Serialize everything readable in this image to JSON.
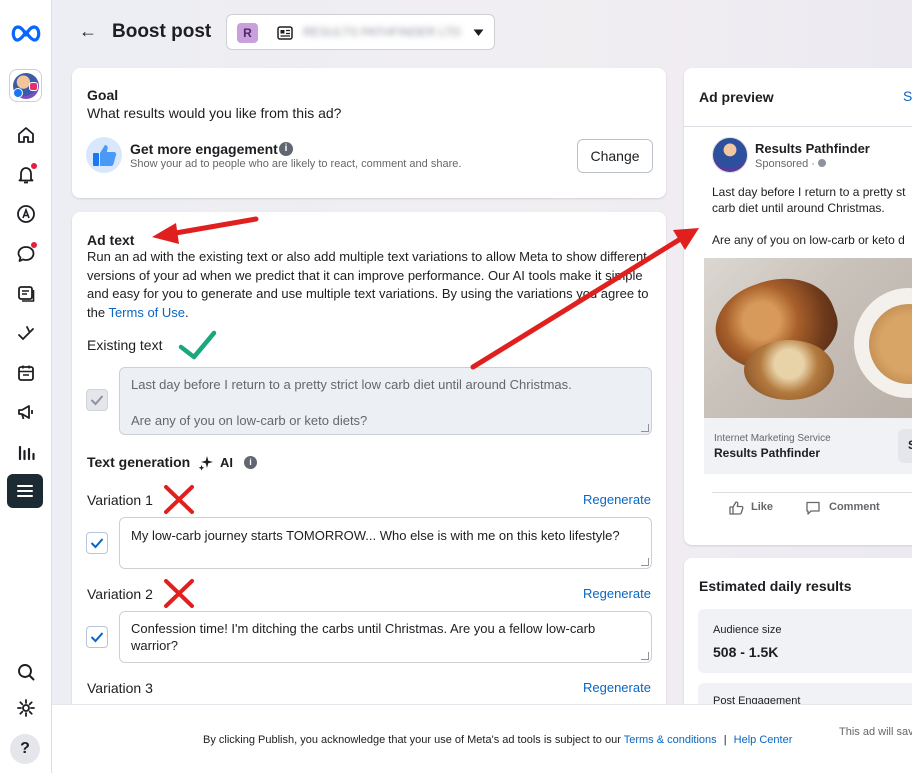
{
  "header": {
    "back_label": "←",
    "title": "Boost post",
    "page_selector_badge": "R",
    "page_selector_name": "RESULTS PATHFINDER LTD"
  },
  "goal": {
    "heading": "Goal",
    "question": "What results would you like from this ad?",
    "option_title": "Get more engagement",
    "option_desc": "Show your ad to people who are likely to react, comment and share.",
    "change_label": "Change"
  },
  "ad_text": {
    "heading": "Ad text",
    "description_before": "Run an ad with the existing text or also add multiple text variations to allow Meta to show different versions of your ad when we predict that it can improve performance. Our AI tools make it simple and easy for you to generate and use multiple text variations. By using the variations you agree to the ",
    "terms_link": "Terms of Use",
    "description_after": ".",
    "existing_label": "Existing text",
    "existing_line1": "Last day before I return to a pretty strict low carb diet until around Christmas.",
    "existing_line2": "Are any of you on low-carb or keto diets?",
    "generation_label": "Text generation",
    "ai_label": "AI",
    "regenerate_label": "Regenerate",
    "variations": [
      {
        "label": "Variation 1",
        "text": "My low-carb journey starts TOMORROW... Who else is with me on this keto lifestyle?"
      },
      {
        "label": "Variation 2",
        "text": "Confession time! I'm ditching the carbs until Christmas. Are you a fellow low-carb warrior?"
      },
      {
        "label": "Variation 3",
        "text": ""
      }
    ]
  },
  "preview": {
    "heading": "Ad preview",
    "see_label": "Se",
    "page_name": "Results Pathfinder",
    "sponsored": "Sponsored · ",
    "post_line1": "Last day before I return to a pretty st",
    "post_line2": "carb diet until around Christmas.",
    "post_line3": "Are any of you on low-carb or keto d",
    "link_category": "Internet Marketing Service",
    "link_name": "Results Pathfinder",
    "cta_partial": "S",
    "like_label": "Like",
    "comment_label": "Comment"
  },
  "estimates": {
    "heading": "Estimated daily results",
    "audience_label": "Audience size",
    "audience_value": "508 - 1.5K",
    "engagement_label": "Post Engagement"
  },
  "footer": {
    "text": "By clicking Publish, you acknowledge that your use of Meta's ad tools is subject to our ",
    "terms_link": "Terms & conditions",
    "separator": "|",
    "help_link": "Help Center",
    "right_text": "This ad will sav"
  },
  "colors": {
    "meta_blue": "#0866ff",
    "link_blue": "#0a66c2",
    "annotation_red": "#e0201e",
    "annotation_green": "#1aa77e"
  }
}
